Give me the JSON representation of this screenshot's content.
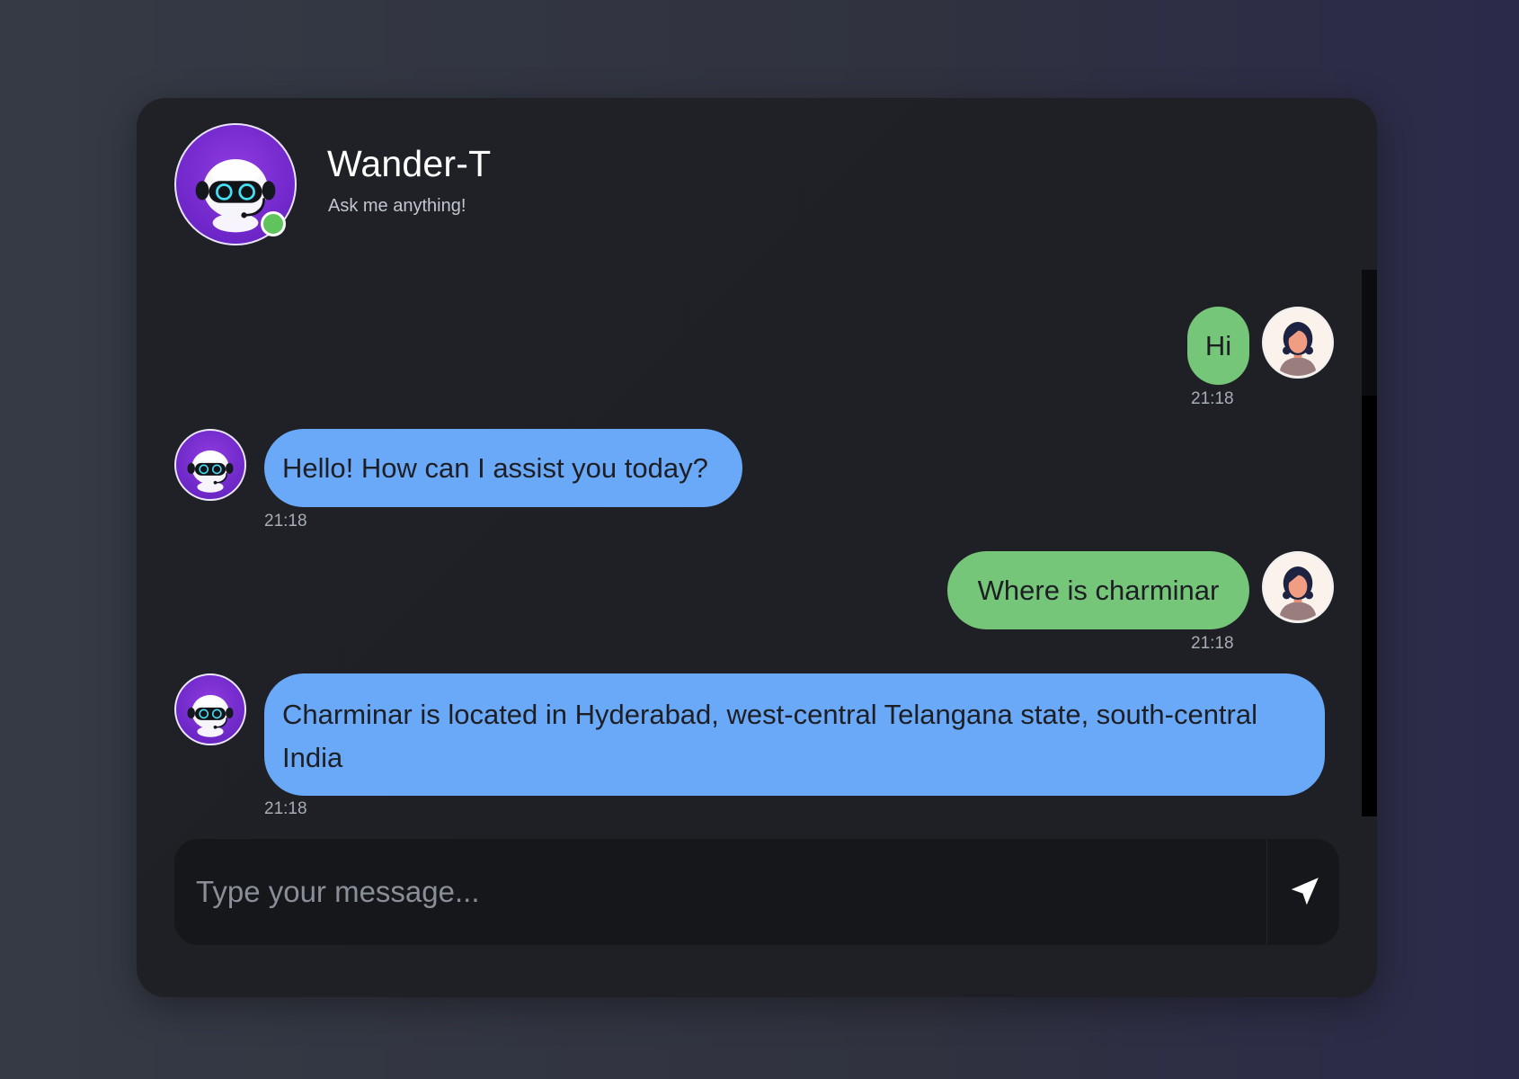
{
  "header": {
    "title": "Wander-T",
    "subtitle": "Ask me anything!",
    "status": "online"
  },
  "messages": [
    {
      "sender": "user",
      "text": "Hi",
      "time": "21:18"
    },
    {
      "sender": "bot",
      "text": "Hello! How can I assist you today?",
      "time": "21:18"
    },
    {
      "sender": "user",
      "text": "Where is charminar",
      "time": "21:18"
    },
    {
      "sender": "bot",
      "text": "Charminar is located in Hyderabad, west-central Telangana state, south-central India",
      "time": "21:18"
    }
  ],
  "composer": {
    "placeholder": "Type your message...",
    "send_icon": "paper-plane-icon"
  },
  "colors": {
    "user_bubble": "#75c679",
    "bot_bubble": "#6aa8f8",
    "accent_purple": "#6e26c9",
    "online_green": "#5fc45b"
  }
}
